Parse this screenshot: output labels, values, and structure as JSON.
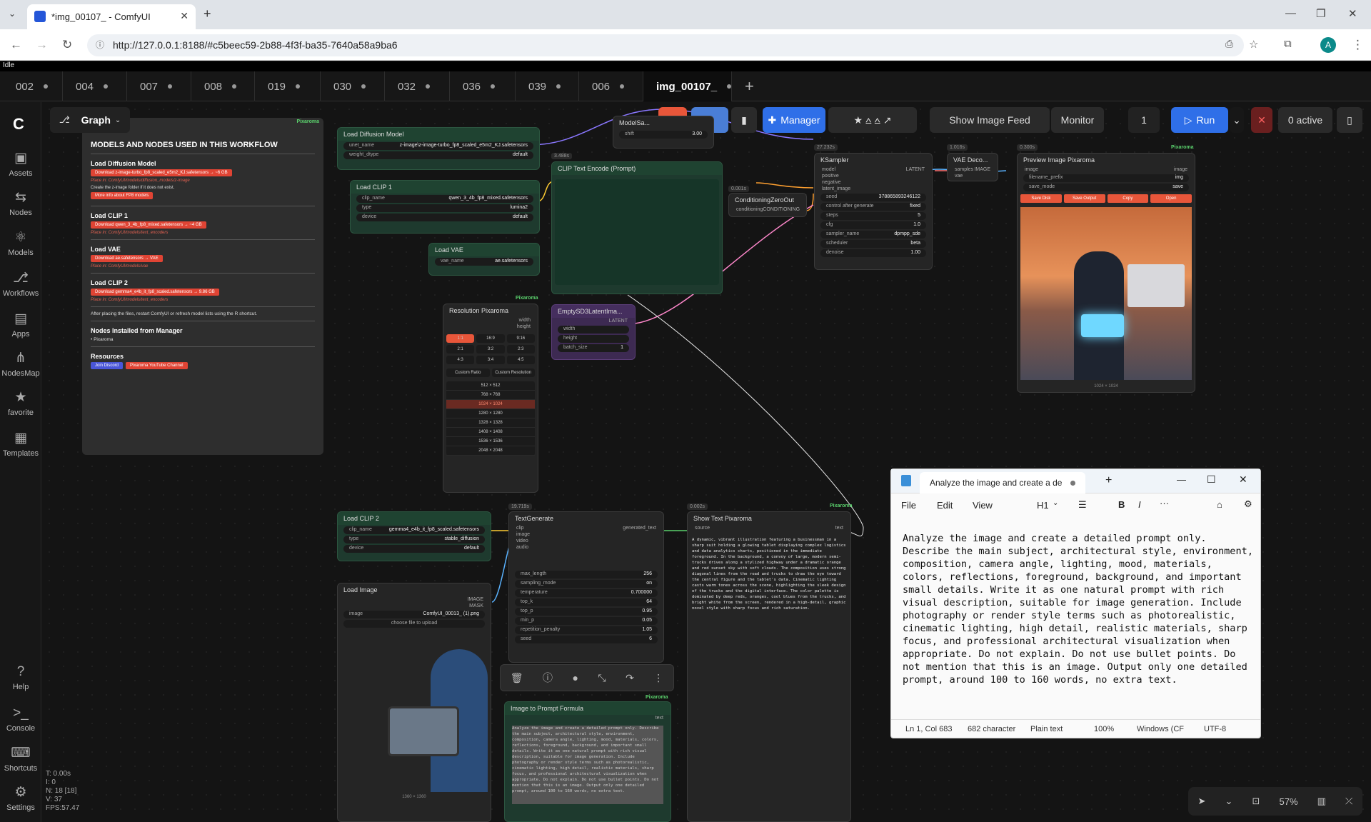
{
  "browser": {
    "tab_title": "*img_00107_ - ComfyUI",
    "url": "http://127.0.0.1:8188/#c5beec59-2b88-4f3f-ba35-7640a58a9ba6",
    "profile_initial": "A"
  },
  "status_strip": "Idle",
  "workflow_tabs": [
    "002",
    "004",
    "007",
    "008",
    "019",
    "030",
    "032",
    "036",
    "039",
    "006",
    "img_00107_"
  ],
  "sidebar": {
    "items": [
      {
        "label": "Assets",
        "icon": "assets-icon"
      },
      {
        "label": "Nodes",
        "icon": "nodes-icon"
      },
      {
        "label": "Models",
        "icon": "models-icon"
      },
      {
        "label": "Workflows",
        "icon": "workflows-icon"
      },
      {
        "label": "Apps",
        "icon": "apps-icon"
      },
      {
        "label": "NodesMap",
        "icon": "nodesmap-icon"
      },
      {
        "label": "favorite",
        "icon": "star-icon"
      },
      {
        "label": "Templates",
        "icon": "templates-icon"
      }
    ],
    "bottom": [
      {
        "label": "Help",
        "icon": "help-icon"
      },
      {
        "label": "Console",
        "icon": "console-icon"
      },
      {
        "label": "Shortcuts",
        "icon": "keyboard-icon"
      },
      {
        "label": "Settings",
        "icon": "gear-icon"
      }
    ]
  },
  "toolbar": {
    "graph_label": "Graph",
    "manager_label": "Manager",
    "image_feed_label": "Show Image Feed",
    "monitor_label": "Monitor",
    "queue_count": "1",
    "run_label": "Run",
    "active_label": "0 active"
  },
  "doc_panel": {
    "title": "MODELS AND NODES USED IN THIS WORKFLOW",
    "load_diffusion": "Load Diffusion Model",
    "load_diffusion_btn": "Download z-image-turbo_fp8_scaled_e5m2_KJ.safetensors → ~6 GB",
    "load_diffusion_place": "Place in: ComfyUI/models/diffusion_models/z-image",
    "create_folder": "Create the z-image folder if it does not exist.",
    "fp8_btn": "More info about FP8 models",
    "load_clip1": "Load CLIP 1",
    "load_clip1_btn": "Download qwen_3_4b_fp8_mixed.safetensors → ~4 GB",
    "load_clip1_place": "Place in: ComfyUI/models/text_encoders",
    "load_vae": "Load VAE",
    "load_vae_btn": "Download ae.safetensors → VAE",
    "load_vae_place": "Place in: ComfyUI/models/vae",
    "load_clip2": "Load CLIP 2",
    "load_clip2_btn": "Download gemma4_e4b_it_fp8_scaled.safetensors → 9.86 GB",
    "load_clip2_place": "Place in: ComfyUI/models/text_encoders",
    "warning": "After placing the files, restart ComfyUI or refresh model lists using the R shortcut.",
    "nodes_installed": "Nodes Installed from Manager",
    "pixaroma": "Pixaroma",
    "resources": "Resources",
    "join_discord": "Join Discord",
    "youtube": "Pixaroma YouTube Channel"
  },
  "nodes": {
    "load_diffusion": {
      "title": "Load Diffusion Model",
      "unet_name": "z-image\\z-image-turbo_fp8_scaled_e5m2_KJ.safetensors",
      "weight_dtype": "default"
    },
    "load_clip1": {
      "title": "Load CLIP 1",
      "clip_name": "qwen_3_4b_fp8_mixed.safetensors",
      "type": "lumina2",
      "device": "default"
    },
    "load_vae": {
      "title": "Load VAE",
      "vae_name": "ae.safetensors"
    },
    "clip_text": {
      "title": "CLIP Text Encode (Prompt)",
      "time": "3.488s"
    },
    "resolution": {
      "title": "Resolution Pixaroma",
      "ratios": [
        "1:1",
        "16:9",
        "9:16",
        "2:1",
        "3:2",
        "2:3",
        "4:3",
        "3:4",
        "4:5"
      ],
      "custom_ratio": "Custom Ratio",
      "custom_res": "Custom Resolution",
      "sizes": [
        "512 × 512",
        "768 × 768",
        "1024 × 1024",
        "1280 × 1280",
        "1328 × 1328",
        "1408 × 1408",
        "1536 × 1536",
        "2048 × 2048"
      ]
    },
    "empty_latent": {
      "title": "EmptySD3LatentIma...",
      "batch_size": "1"
    },
    "cond_zero": {
      "title": "ConditioningZeroOut",
      "time": "0.001s"
    },
    "model_sampling": {
      "title": "ModelSa...",
      "shift": "3.00"
    },
    "ksampler": {
      "title": "KSampler",
      "time": "27.232s",
      "seed": "378865893246122",
      "control": "fixed",
      "steps": "5",
      "cfg": "1.0",
      "sampler": "dpmpp_sde",
      "scheduler": "beta",
      "denoise": "1.00"
    },
    "vae_decode": {
      "title": "VAE Deco...",
      "time": "1.016s"
    },
    "preview": {
      "title": "Preview Image Pixaroma",
      "time": "0.300s",
      "filename_prefix": "img",
      "save_mode": "save",
      "btns": [
        "Save Disk",
        "Save Output",
        "Copy",
        "Open"
      ],
      "size": "1024 × 1024"
    },
    "load_clip2": {
      "title": "Load CLIP 2",
      "clip_name": "gemma4_e4b_it_fp8_scaled.safetensors",
      "type": "stable_diffusion",
      "device": "default"
    },
    "text_generate": {
      "title": "TextGenerate",
      "time": "19.719s",
      "max_length": "256",
      "sampling_mode": "on",
      "temperature": "0.700000",
      "top_k": "64",
      "top_p": "0.95",
      "min_p": "0.05",
      "repetition_penalty": "1.05",
      "seed": "6"
    },
    "show_text": {
      "title": "Show Text Pixaroma",
      "time": "0.002s",
      "text": "A dynamic, vibrant illustration featuring a businessman in a sharp suit holding a glowing tablet displaying complex logistics and data analytics charts, positioned in the immediate foreground. In the background, a convoy of large, modern semi-trucks drives along a stylized highway under a dramatic orange and red sunset sky with soft clouds. The composition uses strong diagonal lines from the road and trucks to draw the eye toward the central figure and the tablet's data. Cinematic lighting casts warm tones across the scene, highlighting the sleek design of the trucks and the digital interface. The color palette is dominated by deep reds, oranges, cool blues from the trucks, and bright white from the screen, rendered in a high-detail, graphic novel style with sharp focus and rich saturation."
    },
    "load_image": {
      "title": "Load Image",
      "image": "ComfyUI_00013_ (1).png",
      "upload": "choose file to upload",
      "size": "1360 × 1360"
    },
    "prompt_formula": {
      "title": "Image to Prompt Formula"
    }
  },
  "stats": {
    "t": "T: 0.00s",
    "i": "I: 0",
    "n": "N: 18 [18]",
    "v": "V: 37",
    "fps": "FPS:57.47"
  },
  "zoom": "57%",
  "notepad": {
    "tab_title": "Analyze the image and create a de",
    "menu": [
      "File",
      "Edit",
      "View"
    ],
    "heading": "H1",
    "body": "Analyze the image and create a detailed prompt only. Describe the main subject, architectural style, environment, composition, camera angle, lighting, mood, materials, colors, reflections, foreground, background, and important small details. Write it as one natural prompt with rich visual description, suitable for image generation. Include photography or render style terms such as photorealistic, cinematic lighting, high detail, realistic materials, sharp focus, and professional architectural visualization when appropriate. Do not explain. Do not use bullet points. Do not mention that this is an image. Output only one detailed prompt, around 100 to 160 words, no extra text.",
    "status": {
      "pos": "Ln 1, Col 683",
      "chars": "682 character",
      "format": "Plain text",
      "zoom": "100%",
      "eol": "Windows (CF",
      "enc": "UTF-8"
    }
  },
  "colors": {
    "accent": "#2f6fe8",
    "green_node": "#1f4331",
    "purple_node": "#452e5e",
    "red": "#e04434"
  }
}
